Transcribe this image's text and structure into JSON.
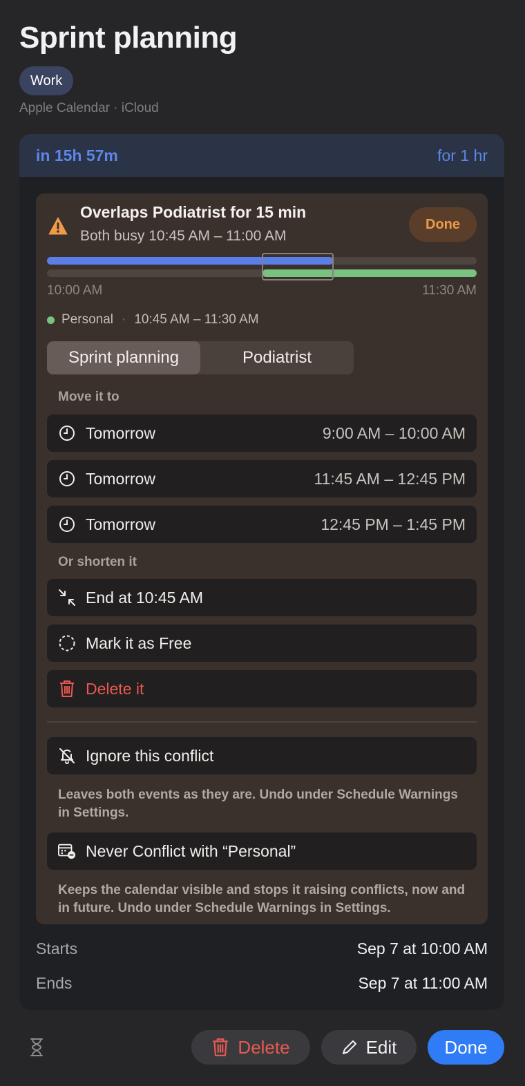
{
  "event": {
    "title": "Sprint planning",
    "tag": "Work",
    "source": "Apple Calendar · iCloud",
    "countdown": "in 15h 57m",
    "duration": "for 1 hr"
  },
  "conflict": {
    "title": "Overlaps Podiatrist for 15 min",
    "subtitle": "Both busy 10:45 AM – 11:00 AM",
    "done_label": "Done",
    "timeline": {
      "start_label": "10:00 AM",
      "end_label": "11:30 AM"
    },
    "other_calendar": "Personal",
    "other_time": "10:45 AM – 11:30 AM",
    "segments": [
      "Sprint planning",
      "Podiatrist"
    ],
    "move_label": "Move it to",
    "move_options": [
      {
        "day": "Tomorrow",
        "time": "9:00 AM – 10:00 AM"
      },
      {
        "day": "Tomorrow",
        "time": "11:45 AM – 12:45 PM"
      },
      {
        "day": "Tomorrow",
        "time": "12:45 PM – 1:45 PM"
      }
    ],
    "shorten_label": "Or shorten it",
    "end_at": "End at 10:45 AM",
    "mark_free": "Mark it as Free",
    "delete_it": "Delete it",
    "ignore": "Ignore this conflict",
    "ignore_note": "Leaves both events as they are. Undo under Schedule Warnings in Settings.",
    "never_conflict": "Never Conflict with “Personal”",
    "never_note": "Keeps the calendar visible and stops it raising conflicts, now and in future. Undo under Schedule Warnings in Settings."
  },
  "details": {
    "starts_label": "Starts",
    "starts_value": "Sep 7 at 10:00 AM",
    "ends_label": "Ends",
    "ends_value": "Sep 7 at 11:00 AM"
  },
  "footer": {
    "delete_label": "Delete",
    "edit_label": "Edit",
    "done_label": "Done"
  },
  "colors": {
    "accent_blue": "#2f7cf6",
    "warning_orange": "#f09b4a",
    "danger_red": "#e8594f",
    "personal_green": "#7ac27f",
    "work_blue": "#5b7fe6"
  },
  "icons": [
    "warning-icon",
    "clock-icon",
    "collapse-icon",
    "dashed-circle-icon",
    "trash-icon",
    "bell-slash-icon",
    "calendar-minus-icon",
    "hourglass-icon",
    "pencil-icon"
  ]
}
